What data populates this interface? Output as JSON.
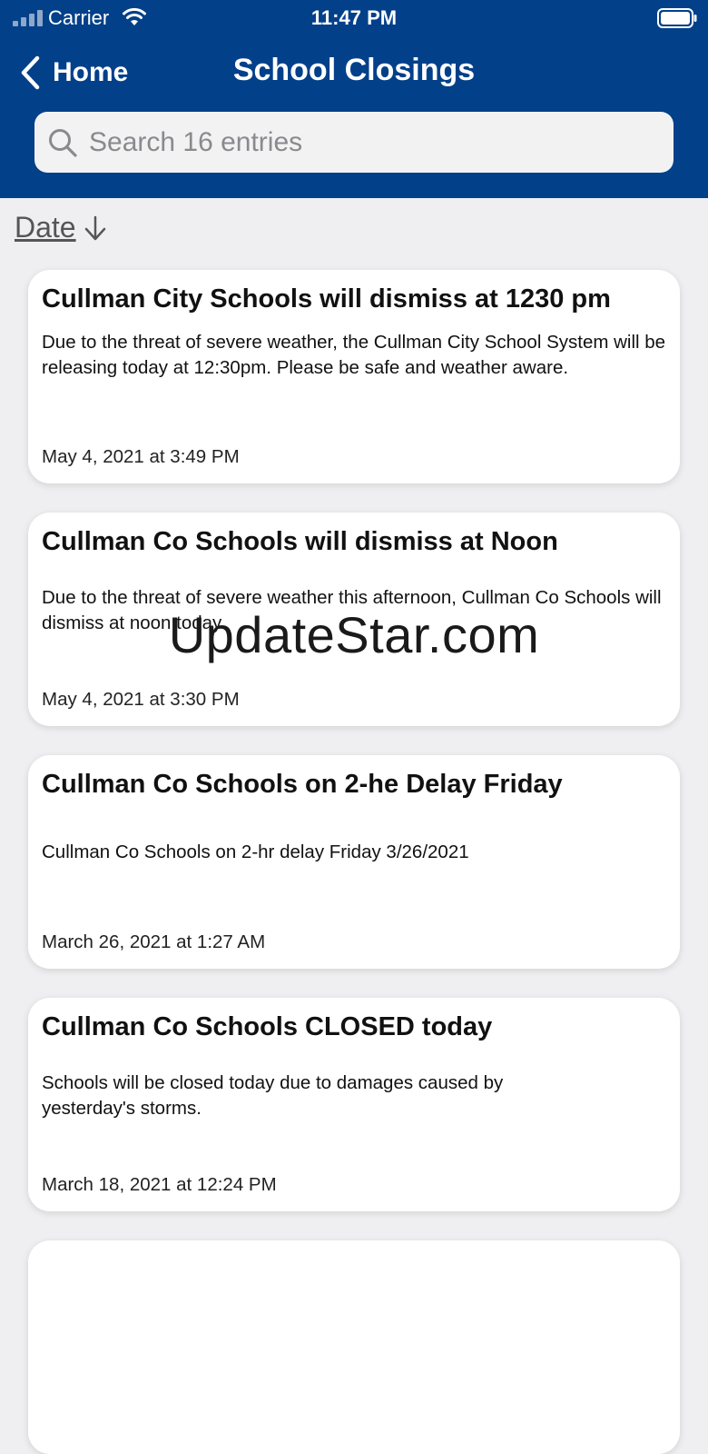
{
  "status_bar": {
    "carrier": "Carrier",
    "time": "11:47 PM"
  },
  "nav": {
    "back_label": "Home",
    "title": "School Closings"
  },
  "search": {
    "placeholder": "Search 16 entries"
  },
  "sort": {
    "label": "Date"
  },
  "entries": [
    {
      "title": "Cullman City Schools will dismiss at 1230 pm",
      "body": "Due to the threat of severe weather, the Cullman City School System will be releasing today at 12:30pm. Please be safe and weather aware.",
      "date": "May 4, 2021 at 3:49 PM"
    },
    {
      "title": "Cullman Co Schools will dismiss at Noon",
      "body": "Due to the threat of severe weather this afternoon, Cullman Co Schools will dismiss at noon today.",
      "date": "May 4, 2021 at 3:30 PM"
    },
    {
      "title": "Cullman Co Schools on 2-he Delay Friday",
      "body": "Cullman Co Schools on 2-hr delay Friday 3/26/2021",
      "date": "March 26, 2021 at 1:27 AM"
    },
    {
      "title": "Cullman Co Schools CLOSED today",
      "body": "Schools will be closed today due to damages caused by yesterday's storms.",
      "date": "March 18, 2021 at 12:24 PM"
    }
  ],
  "watermark": "UpdateStar.com",
  "colors": {
    "header_blue": "#03408a",
    "background": "#efeff1",
    "card": "#ffffff"
  }
}
